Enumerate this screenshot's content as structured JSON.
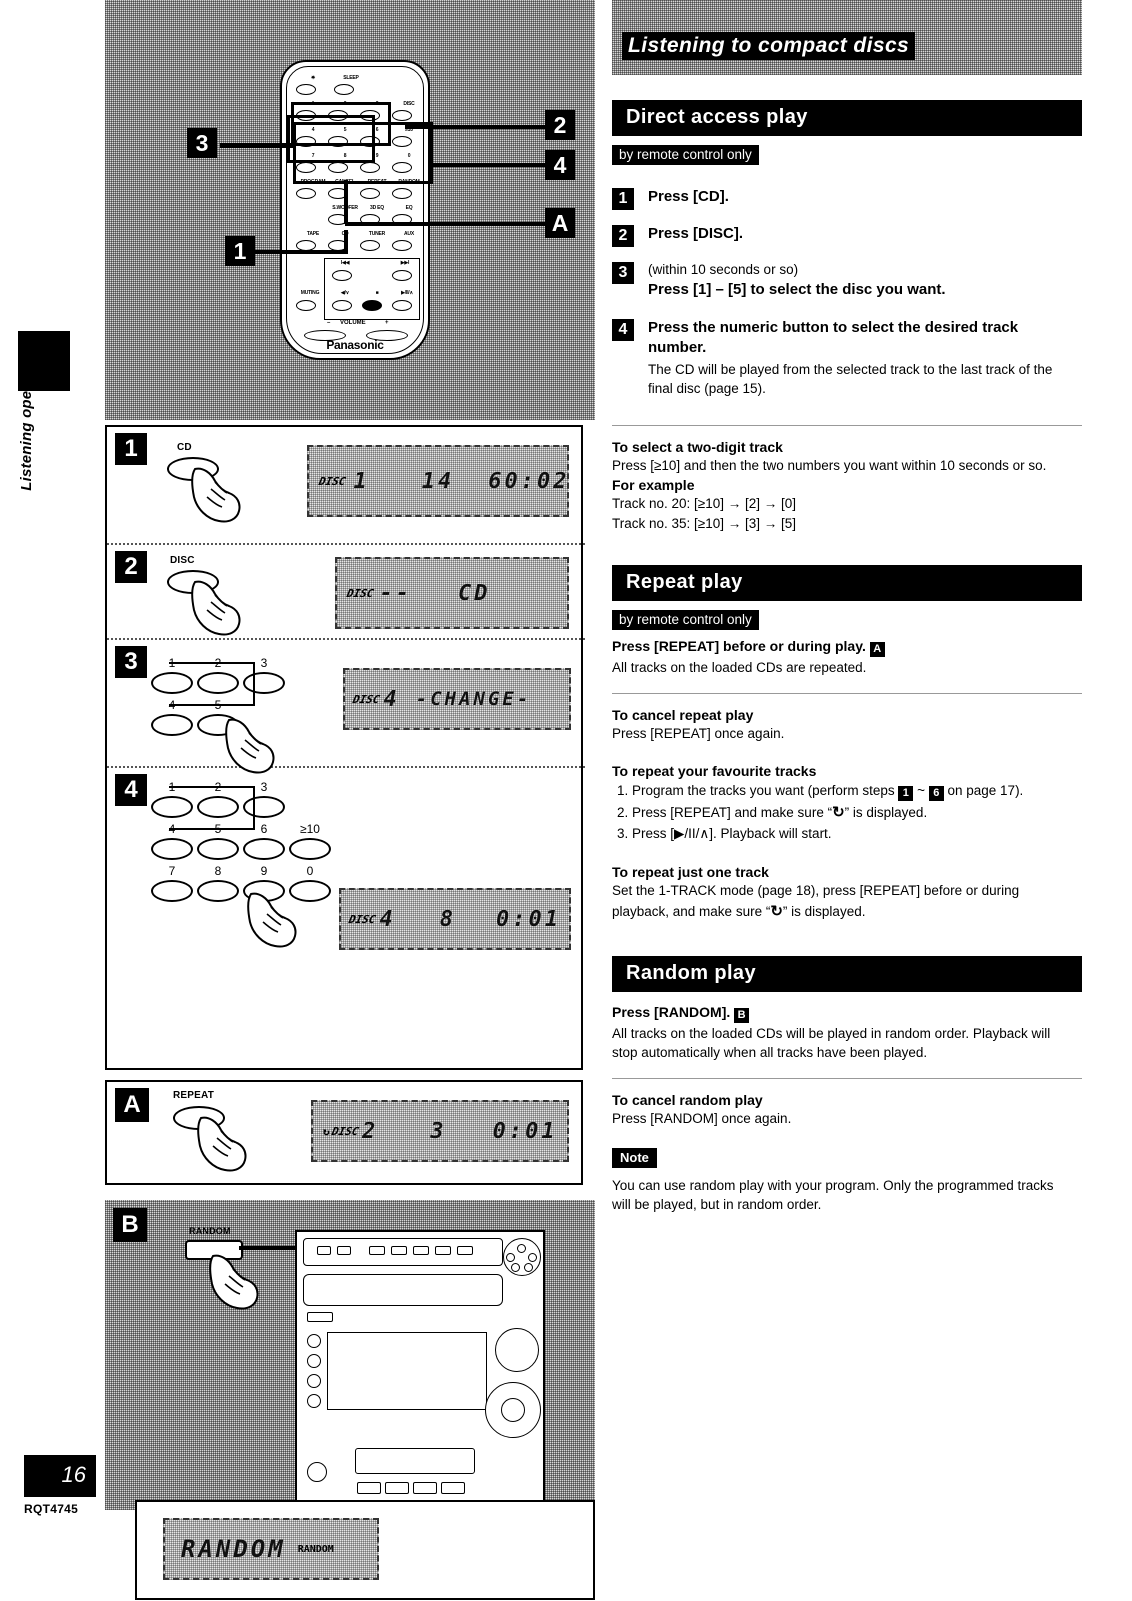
{
  "page": {
    "number": "16",
    "doc_code": "RQT4745",
    "side_tab_label": "Listening operations",
    "chapter_title": "Listening to compact discs"
  },
  "sections": {
    "direct_access": {
      "heading": "Direct access play",
      "tagline": "by remote control only",
      "steps": [
        {
          "num": "1",
          "title": "Press [CD].",
          "pre": "",
          "detail": ""
        },
        {
          "num": "2",
          "title": "Press [DISC].",
          "pre": "",
          "detail": ""
        },
        {
          "num": "3",
          "pre": "(within 10 seconds or so)",
          "title": "Press [1] – [5] to select the disc you want.",
          "detail": ""
        },
        {
          "num": "4",
          "pre": "",
          "title": "Press the numeric button to select the desired track number.",
          "detail": "The CD will be played from the selected track to the last track of the final disc (page 15)."
        }
      ],
      "two_digit": {
        "heading": "To select a two-digit track",
        "body": "Press [≥10] and then the two numbers you want within 10 seconds or so.",
        "example_heading": "For example",
        "examples": [
          "Track no. 20: [≥10] → [2] → [0]",
          "Track no. 35: [≥10] → [3] → [5]"
        ]
      }
    },
    "repeat": {
      "heading": "Repeat play",
      "tagline": "by remote control only",
      "instruction": "Press [REPEAT] before or during play.",
      "instruction_badge": "A",
      "instruction_body": "All tracks on the loaded CDs are repeated.",
      "cancel_heading": "To cancel repeat play",
      "cancel_body": "Press [REPEAT] once again.",
      "favourite_heading": "To repeat your favourite tracks",
      "favourite_steps": [
        {
          "pre": "Program the tracks you want (perform steps ",
          "badge1": "1",
          "mid": " ~ ",
          "badge2": "6",
          "post": " on page 17)."
        },
        {
          "text_a": "Press [REPEAT] and make sure “",
          "glyph": "↻",
          "text_b": "” is displayed."
        },
        {
          "text_a": "Press [▶/II/∧]. Playback will start.",
          "glyph": "",
          "text_b": ""
        }
      ],
      "one_track_heading": "To repeat just one track",
      "one_track_body_a": "Set the 1-TRACK mode (page 18), press [REPEAT] before or during playback, and make sure “",
      "one_track_glyph": "↻",
      "one_track_body_b": "” is displayed."
    },
    "random": {
      "heading": "Random play",
      "instruction": "Press [RANDOM].",
      "instruction_badge": "B",
      "instruction_body": "All tracks on the loaded CDs will be played in random order. Playback will stop automatically when all tracks have been played.",
      "cancel_heading": "To cancel random play",
      "cancel_body": "Press [RANDOM] once again.",
      "note_label": "Note",
      "note_body": "You can use random play with your program. Only the programmed tracks will be played, but in random order."
    }
  },
  "remote": {
    "brand": "Panasonic",
    "top_labels": [
      "SLEEP"
    ],
    "power_icon": "power-icon",
    "keypad": [
      [
        "1",
        "2",
        "3",
        "DISC"
      ],
      [
        "4",
        "5",
        "6",
        "≥10"
      ],
      [
        "7",
        "8",
        "9",
        "0"
      ]
    ],
    "function_rows": [
      [
        "PROGRAM",
        "CANCEL",
        "REPEAT",
        "RANDOM"
      ],
      [
        "S.WOOFER",
        "3D EQ",
        "EQ"
      ],
      [
        "TAPE",
        "CD",
        "TUNER",
        "AUX"
      ]
    ],
    "transport_labels": [
      "I◀◀",
      "▶▶I",
      "MUTING",
      "◀/∨",
      "■",
      "▶/II/∧"
    ],
    "volume_label": "VOLUME",
    "volume_minus": "–",
    "volume_plus": "+",
    "callouts": [
      "3",
      "2",
      "4",
      "1",
      "A"
    ]
  },
  "illustrations": {
    "step1": {
      "num": "1",
      "button_label": "CD",
      "lcd": {
        "disc_icon": "DISC",
        "disc": "1",
        "track": "14",
        "time": "60:02"
      }
    },
    "step2": {
      "num": "2",
      "button_label": "DISC",
      "lcd": {
        "disc_icon": "DISC",
        "disc": "--",
        "mode": "CD"
      }
    },
    "step3": {
      "num": "3",
      "keys": [
        "1",
        "2",
        "3",
        "4",
        "5"
      ],
      "lcd": {
        "disc_icon": "DISC",
        "disc": "4",
        "message": "-CHANGE-"
      }
    },
    "step4": {
      "num": "4",
      "keys": [
        "1",
        "2",
        "3",
        "4",
        "5",
        "6",
        "≥10",
        "7",
        "8",
        "9",
        "0"
      ],
      "lcd": {
        "disc_icon": "DISC",
        "disc": "4",
        "track": "8",
        "time": "0:01"
      }
    },
    "panelA": {
      "tag": "A",
      "button_label": "REPEAT",
      "lcd": {
        "repeat_icon": "↻",
        "disc_icon": "DISC",
        "disc": "2",
        "track": "3",
        "time": "0:01"
      }
    },
    "panelB": {
      "tag": "B",
      "button_label": "RANDOM"
    },
    "panelC": {
      "lcd": {
        "message": "RANDOM",
        "indicator": "RANDOM"
      }
    }
  }
}
